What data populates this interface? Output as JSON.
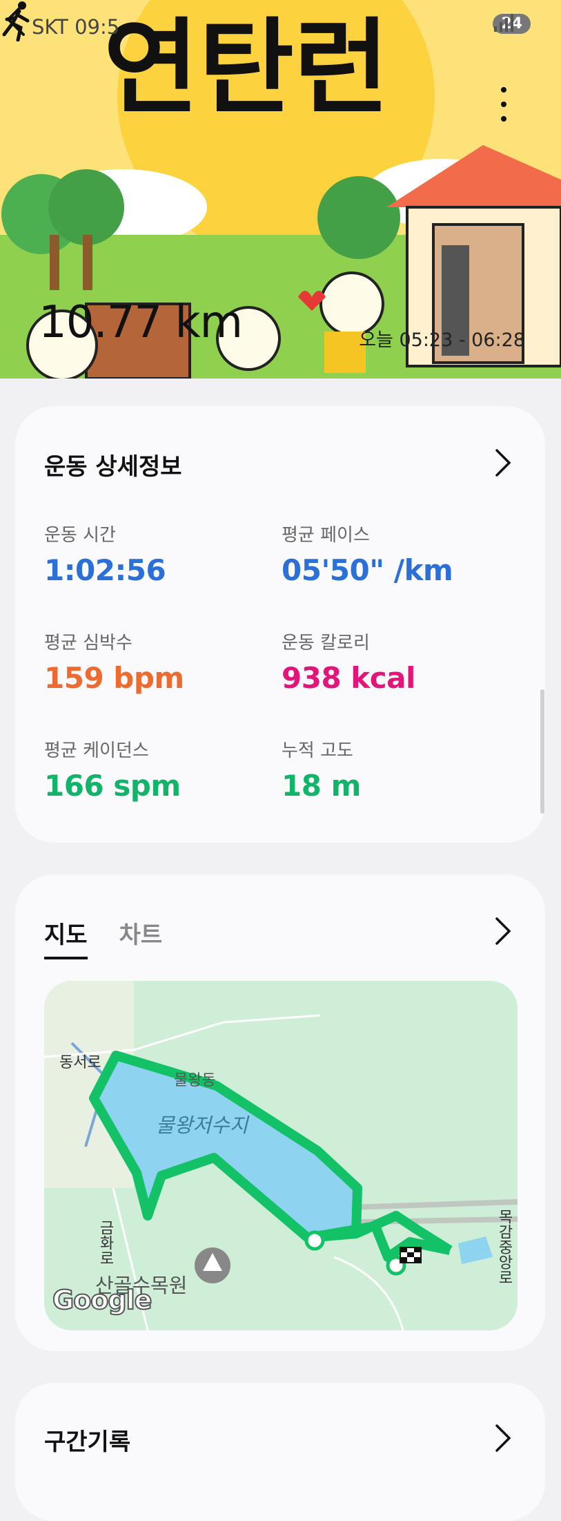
{
  "status_bar": {
    "carrier_time": "SKT 09:5",
    "battery": "24"
  },
  "hero": {
    "distance": "10.77 km",
    "time_range": "오늘 05:23 - 06:28",
    "banner_text": "연탄런"
  },
  "details": {
    "title": "운동 상세정보",
    "metrics": [
      {
        "label": "운동 시간",
        "value": "1:02:56",
        "color": "#2b6fd8"
      },
      {
        "label": "평균 페이스",
        "value": "05'50\" /km",
        "color": "#2b6fd8"
      },
      {
        "label": "평균 심박수",
        "value": "159 bpm",
        "color": "#ee6a2f"
      },
      {
        "label": "운동 칼로리",
        "value": "938 kcal",
        "color": "#e3157a"
      },
      {
        "label": "평균 케이던스",
        "value": "166 spm",
        "color": "#12b46a"
      },
      {
        "label": "누적 고도",
        "value": "18 m",
        "color": "#12b46a"
      }
    ]
  },
  "map_card": {
    "tabs": [
      {
        "label": "지도",
        "active": true
      },
      {
        "label": "차트",
        "active": false
      }
    ],
    "labels": {
      "road_dongseo": "동서로",
      "area_mulwang": "물왕동",
      "lake": "물왕저수지",
      "road_geumhwa": "금화로",
      "arboretum": "산골수목원",
      "road_mokgam": "목감중앙로",
      "attribution": "Google"
    }
  },
  "splits": {
    "title": "구간기록"
  }
}
